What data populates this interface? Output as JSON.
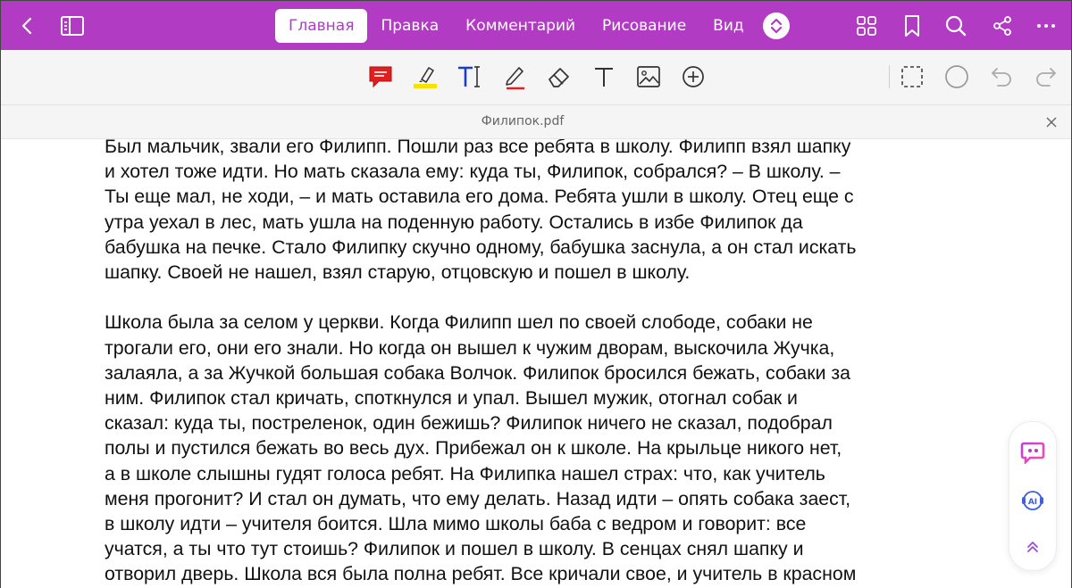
{
  "topbar": {
    "tabs": [
      {
        "label": "Главная",
        "active": true
      },
      {
        "label": "Правка",
        "active": false
      },
      {
        "label": "Комментарий",
        "active": false
      },
      {
        "label": "Рисование",
        "active": false
      },
      {
        "label": "Вид",
        "active": false
      }
    ],
    "icons": [
      "back-icon",
      "panel-icon",
      "expand-icon",
      "grid-icon",
      "bookmark-icon",
      "search-icon",
      "share-icon",
      "more-icon"
    ]
  },
  "toolbar": {
    "tools": [
      "note-icon",
      "highlighter-icon",
      "text-box-icon",
      "pen-icon",
      "eraser-icon",
      "text-icon",
      "image-icon",
      "add-icon",
      "lasso-select-icon",
      "shape-icon",
      "undo-icon",
      "redo-icon"
    ]
  },
  "file": {
    "name": "Филипок.pdf"
  },
  "document": {
    "paragraphs": [
      [
        "Был мальчик, звали его Филипп. Пошли раз все ребята в школу. Филипп взял шапку",
        "и хотел тоже идти. Но мать сказала ему: куда ты, Филипок, собрался? – В школу. –",
        "Ты еще мал, не ходи, – и мать оставила его дома. Ребята ушли в школу. Отец еще с",
        "утра уехал в лес, мать ушла на поденную работу. Остались в избе Филипок да",
        "бабушка на печке. Стало Филипку скучно одному, бабушка заснула, а он стал искать",
        "шапку. Своей не нашел, взял старую, отцовскую и пошел в школу."
      ],
      [
        "Школа была за селом у церкви. Когда Филипп шел по своей слободе, собаки не",
        "трогали его, они его знали. Но когда он вышел к чужим дворам, выскочила Жучка,",
        "залаяла, а за Жучкой большая собака Волчок. Филипок бросился бежать, собаки за",
        "ним. Филипок стал кричать, споткнулся и упал. Вышел мужик, отогнал собак и",
        "сказал: куда ты, постреленок, один бежишь? Филипок ничего не сказал, подобрал",
        "полы и пустился бежать во весь дух. Прибежал он к школе. На крыльце никого нет,",
        "а в школе слышны гудят голоса ребят. На Филипка нашел страх: что, как учитель",
        "меня прогонит? И стал он думать, что ему делать. Назад идти – опять собака заест,",
        "в школу идти – учителя боится. Шла мимо школы баба с ведром и говорит: все",
        "учатся, а ты что тут стоишь? Филипок и пошел в школу. В сенцах снял шапку и",
        "отворил дверь. Школа вся была полна ребят. Все кричали свое, и учитель в красном"
      ]
    ]
  },
  "sidepanel": {
    "buttons": [
      "assistant-icon",
      "ai-voice-icon",
      "collapse-up-icon"
    ]
  },
  "colors": {
    "accent": "#b23bc4",
    "note": "#e02020",
    "highlight": "#f5e400",
    "text_tool": "#1a3ccf",
    "pen": "#e02020"
  }
}
